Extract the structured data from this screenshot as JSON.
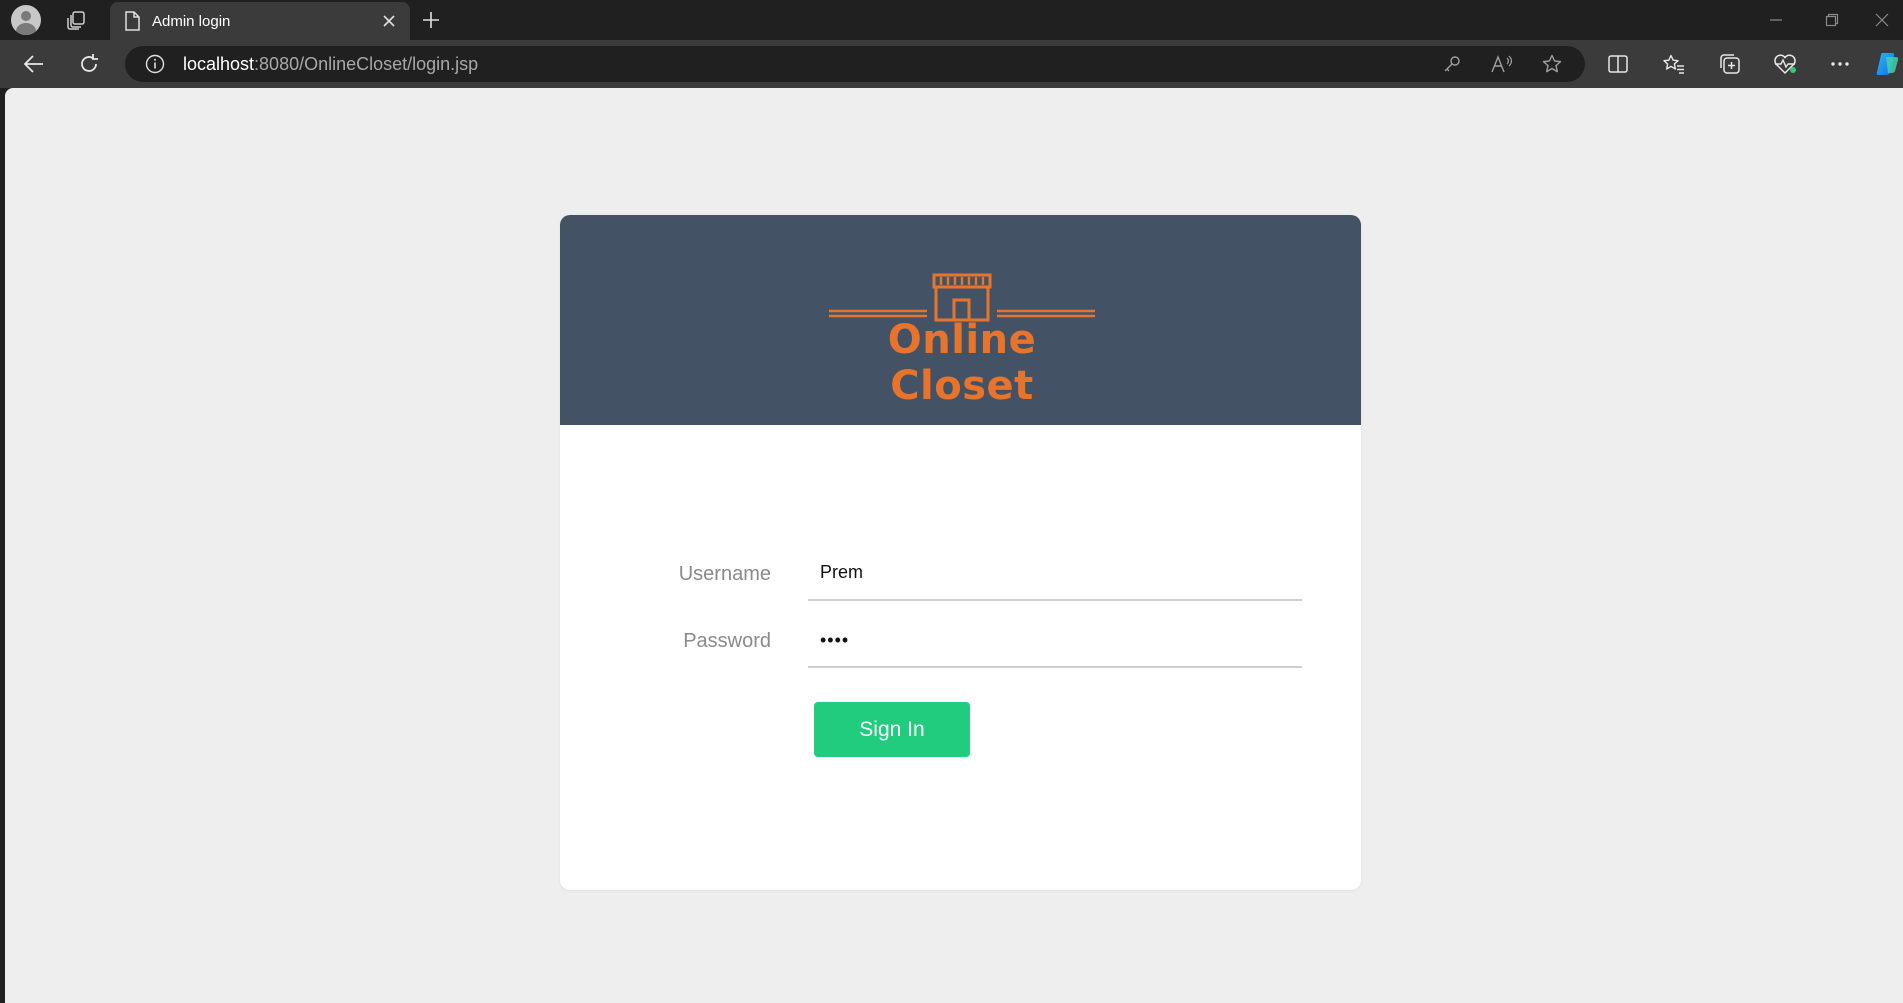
{
  "browser": {
    "tab": {
      "title": "Admin login",
      "close_icon": "close-icon",
      "page_icon": "document-icon"
    },
    "address_bar": {
      "host": "localhost",
      "path": ":8080/OnlineCloset/login.jsp"
    },
    "icons": {
      "profile": "profile-avatar",
      "workspaces": "tab-actions-icon",
      "new_tab": "plus-icon",
      "back": "back-arrow-icon",
      "refresh": "refresh-icon",
      "site_info": "info-icon",
      "password": "key-icon",
      "read_aloud": "read-aloud-icon",
      "favorite": "star-icon",
      "split_screen": "split-screen-icon",
      "favorites": "favorites-icon",
      "collections": "collections-icon",
      "health": "browser-essentials-icon",
      "more": "more-icon",
      "copilot": "copilot-icon"
    }
  },
  "login": {
    "brand": "Online Closet",
    "username_label": "Username",
    "username_value": "Prem",
    "password_label": "Password",
    "password_mask": "••••",
    "sign_in_label": "Sign In"
  },
  "colors": {
    "header_bg": "#435365",
    "brand_orange": "#e8742c",
    "button_green": "#21cc7e",
    "page_bg": "#eeeeee"
  }
}
